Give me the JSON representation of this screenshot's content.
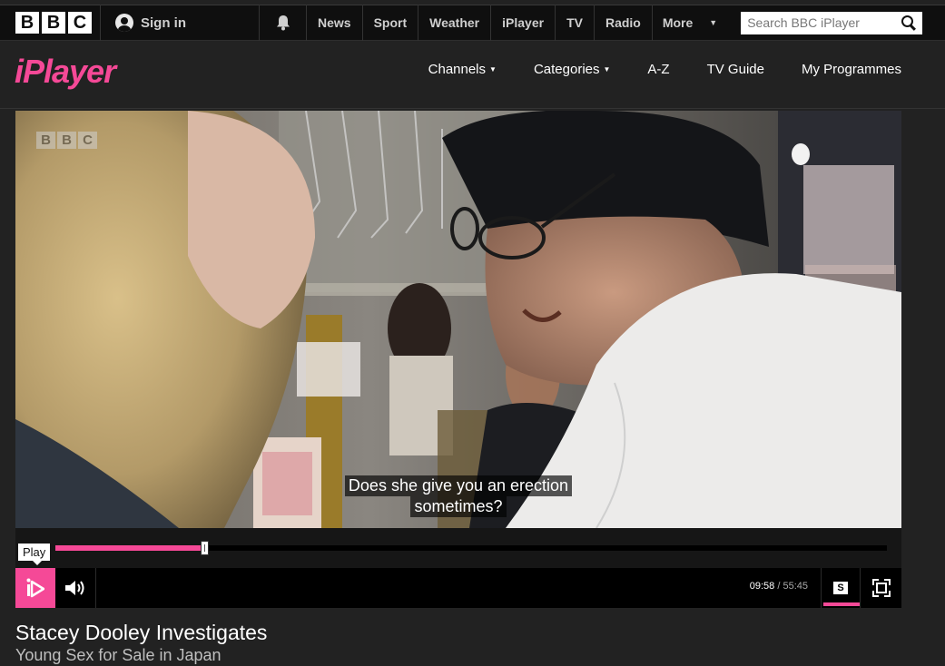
{
  "bbc_bar": {
    "logo": [
      "B",
      "B",
      "C"
    ],
    "sign_in": "Sign in",
    "nav_links": [
      "News",
      "Sport",
      "Weather",
      "iPlayer",
      "TV",
      "Radio"
    ],
    "more": "More",
    "search_placeholder": "Search BBC iPlayer",
    "icons": {
      "account": "user-icon",
      "notifications": "bell-icon",
      "search": "search-icon"
    }
  },
  "iplayer_header": {
    "logo_text": "iPlayer",
    "brand_color": "#f54997",
    "nav": [
      {
        "label": "Channels",
        "dropdown": true
      },
      {
        "label": "Categories",
        "dropdown": true
      },
      {
        "label": "A-Z",
        "dropdown": false
      },
      {
        "label": "TV Guide",
        "dropdown": false
      },
      {
        "label": "My Programmes",
        "dropdown": false
      }
    ]
  },
  "player": {
    "watermark": [
      "B",
      "B",
      "C"
    ],
    "subtitle_lines": [
      "Does she give you an erection",
      "sometimes?"
    ],
    "tooltip": "Play",
    "elapsed": "09:58",
    "separator": "/",
    "duration": "55:45",
    "progress_fraction": 0.179,
    "subtitles_label": "S",
    "subtitles_on": true,
    "icons": {
      "play": "iplayer-play-icon",
      "volume": "volume-icon",
      "fullscreen": "fullscreen-icon"
    }
  },
  "programme": {
    "title": "Stacey Dooley Investigates",
    "episode": "Young Sex for Sale in Japan"
  }
}
